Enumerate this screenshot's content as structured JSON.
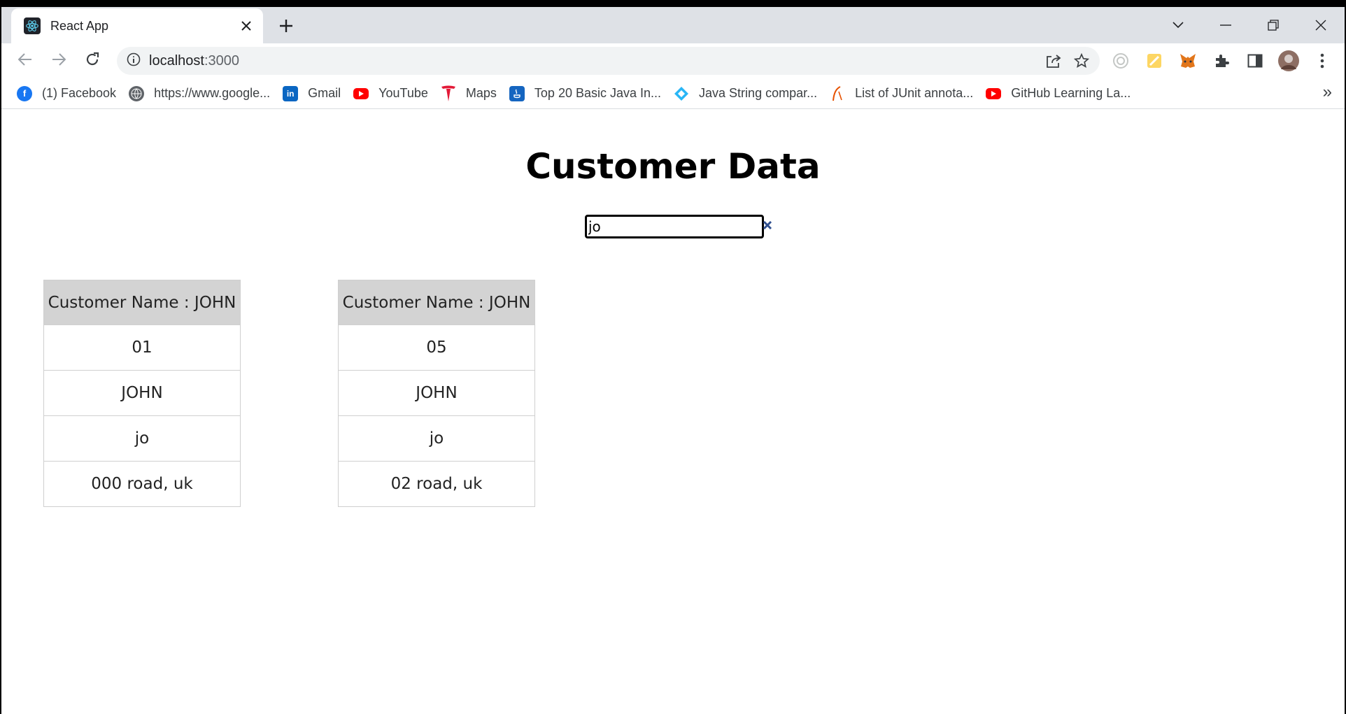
{
  "browser": {
    "tab": {
      "title": "React App",
      "favicon": "react-icon"
    },
    "url": {
      "host": "localhost",
      "port": ":3000"
    },
    "bookmarks": [
      {
        "label": "(1) Facebook",
        "icon": "facebook-icon",
        "color": "#1877f2"
      },
      {
        "label": "https://www.google...",
        "icon": "globe-icon",
        "color": "#5f6368"
      },
      {
        "label": "Gmail",
        "icon": "linkedin-icon",
        "color": "#0a66c2"
      },
      {
        "label": "YouTube",
        "icon": "youtube-icon",
        "color": "#ff0000"
      },
      {
        "label": "Maps",
        "icon": "tesla-icon",
        "color": "#e31937"
      },
      {
        "label": "Top 20 Basic Java In...",
        "icon": "java-icon",
        "color": "#1565c0"
      },
      {
        "label": "Java String compar...",
        "icon": "diamond-icon",
        "color": "#29b6f6"
      },
      {
        "label": "List of JUnit annota...",
        "icon": "junit-icon",
        "color": "#e65100"
      },
      {
        "label": "GitHub Learning La...",
        "icon": "youtube-icon",
        "color": "#ff0000"
      }
    ],
    "bookmarks_more": "»"
  },
  "page": {
    "title": "Customer Data",
    "search": {
      "value": "jo"
    },
    "cards": [
      {
        "header": "Customer Name : JOHN",
        "id": "01",
        "name": "JOHN",
        "nickname": "jo",
        "address": "000 road, uk"
      },
      {
        "header": "Customer Name : JOHN",
        "id": "05",
        "name": "JOHN",
        "nickname": "jo",
        "address": "02 road, uk"
      }
    ]
  }
}
